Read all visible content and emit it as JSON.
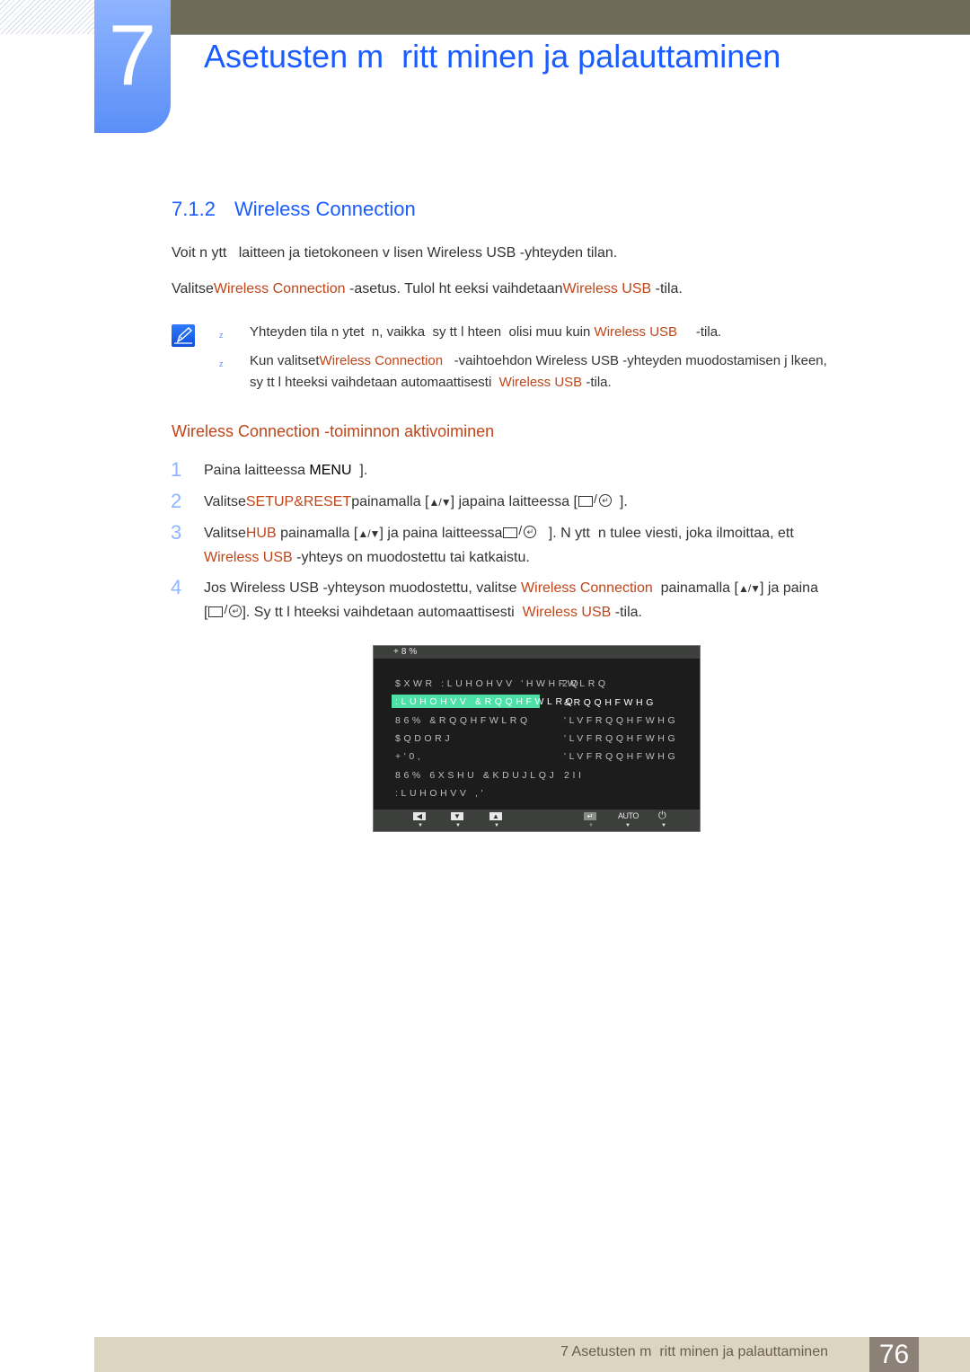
{
  "header": {
    "chapter_number": "7",
    "chapter_title": "Asetusten m  ritt minen ja palauttaminen"
  },
  "section": {
    "number": "7.1.2",
    "title": "Wireless Connection"
  },
  "intro": {
    "line1": "Voit n ytt   laitteen ja tietokoneen v lisen Wireless USB -yhteyden tilan.",
    "line2_a": "Valitse",
    "line2_b": "Wireless Connection",
    "line2_c": " -asetus. Tulol ht eeksi vaihdetaan",
    "line2_d": "Wireless USB",
    "line2_e": " -tila."
  },
  "notes": [
    {
      "bullet": "z",
      "a": "Yhteyden tila n ytet  n, vaikka  sy tt l hteen  olisi muu kuin ",
      "b": "Wireless USB",
      "c": "     -tila."
    },
    {
      "bullet": "z",
      "a": "Kun valitset",
      "b": "Wireless Connection",
      "c": "   -vaihtoehdon Wireless USB -yhteyden muodostamisen j lkeen,",
      "d": "sy tt l hteeksi vaihdetaan automaattisesti  ",
      "e": "Wireless USB",
      "f": " -tila."
    }
  ],
  "subheading": "Wireless Connection -toiminnon aktivoiminen",
  "steps": [
    {
      "num": "1",
      "a": "Paina laitteessa ",
      "b": "MENU",
      "c": "  ]."
    },
    {
      "num": "2",
      "a": "Valitse",
      "b": "SETUP&RESET",
      "c": "painamalla [",
      "d": "] japaina laitteessa [",
      "e": "  ]."
    },
    {
      "num": "3",
      "a": "Valitse",
      "b": "HUB",
      "c": " painamalla [",
      "d": "] ja paina laitteessa",
      "e": "   ]. N ytt  n tulee viesti, joka ilmoittaa, ett",
      "f": "Wireless USB",
      "g": " -yhteys on muodostettu tai katkaistu."
    },
    {
      "num": "4",
      "a": "Jos Wireless USB -yhteyson muodostettu, valitse ",
      "b": "Wireless Connection",
      "c": "  painamalla [",
      "d": "] ja paina",
      "e": "[",
      "f": "]. Sy tt l hteeksi vaihdetaan automaattisesti  ",
      "g": "Wireless USB",
      "h": " -tila."
    }
  ],
  "keys": {
    "up_down": "▲/▼",
    "source_slash": "/",
    "enter": "↵"
  },
  "osd": {
    "title": "+8%",
    "rows": [
      {
        "label": "$XWR :LUHOHVV 'HWHFWLRQ",
        "value": "2Q"
      },
      {
        "label": ":LUHOHVV &RQQHFWLRQ",
        "value": "&RQQHFWHG",
        "selected": true
      },
      {
        "label": "86% &RQQHFWLRQ",
        "value": "'LVFRQQHFWHG"
      },
      {
        "label": "$QDORJ",
        "value": "'LVFRQQHFWHG"
      },
      {
        "label": "+'0,",
        "value": "'LVFRQQHFWHG"
      },
      {
        "label": "86% 6XSHU &KDUJLQJ",
        "value": "2II"
      },
      {
        "label": ":LUHOHVV ,'",
        "value": ""
      }
    ],
    "buttons": [
      {
        "name": "left",
        "glyph": "◀"
      },
      {
        "name": "down",
        "glyph": "▼"
      },
      {
        "name": "up",
        "glyph": "▲"
      },
      {
        "name": "enter",
        "glyph": "↵"
      },
      {
        "name": "auto",
        "glyph": "AUTO"
      },
      {
        "name": "power",
        "glyph": "⏻"
      }
    ],
    "indicator": "▼",
    "highlight_color": "#4fe0a8"
  },
  "footer": {
    "text": "7 Asetusten m  ritt minen ja palauttaminen",
    "page": "76"
  },
  "colors": {
    "heading_blue": "#1a5cff",
    "highlight_orange": "#c0461a",
    "topbar": "#6e6b59",
    "footer_bg": "#dcd5c0",
    "page_box": "#8c8176"
  }
}
